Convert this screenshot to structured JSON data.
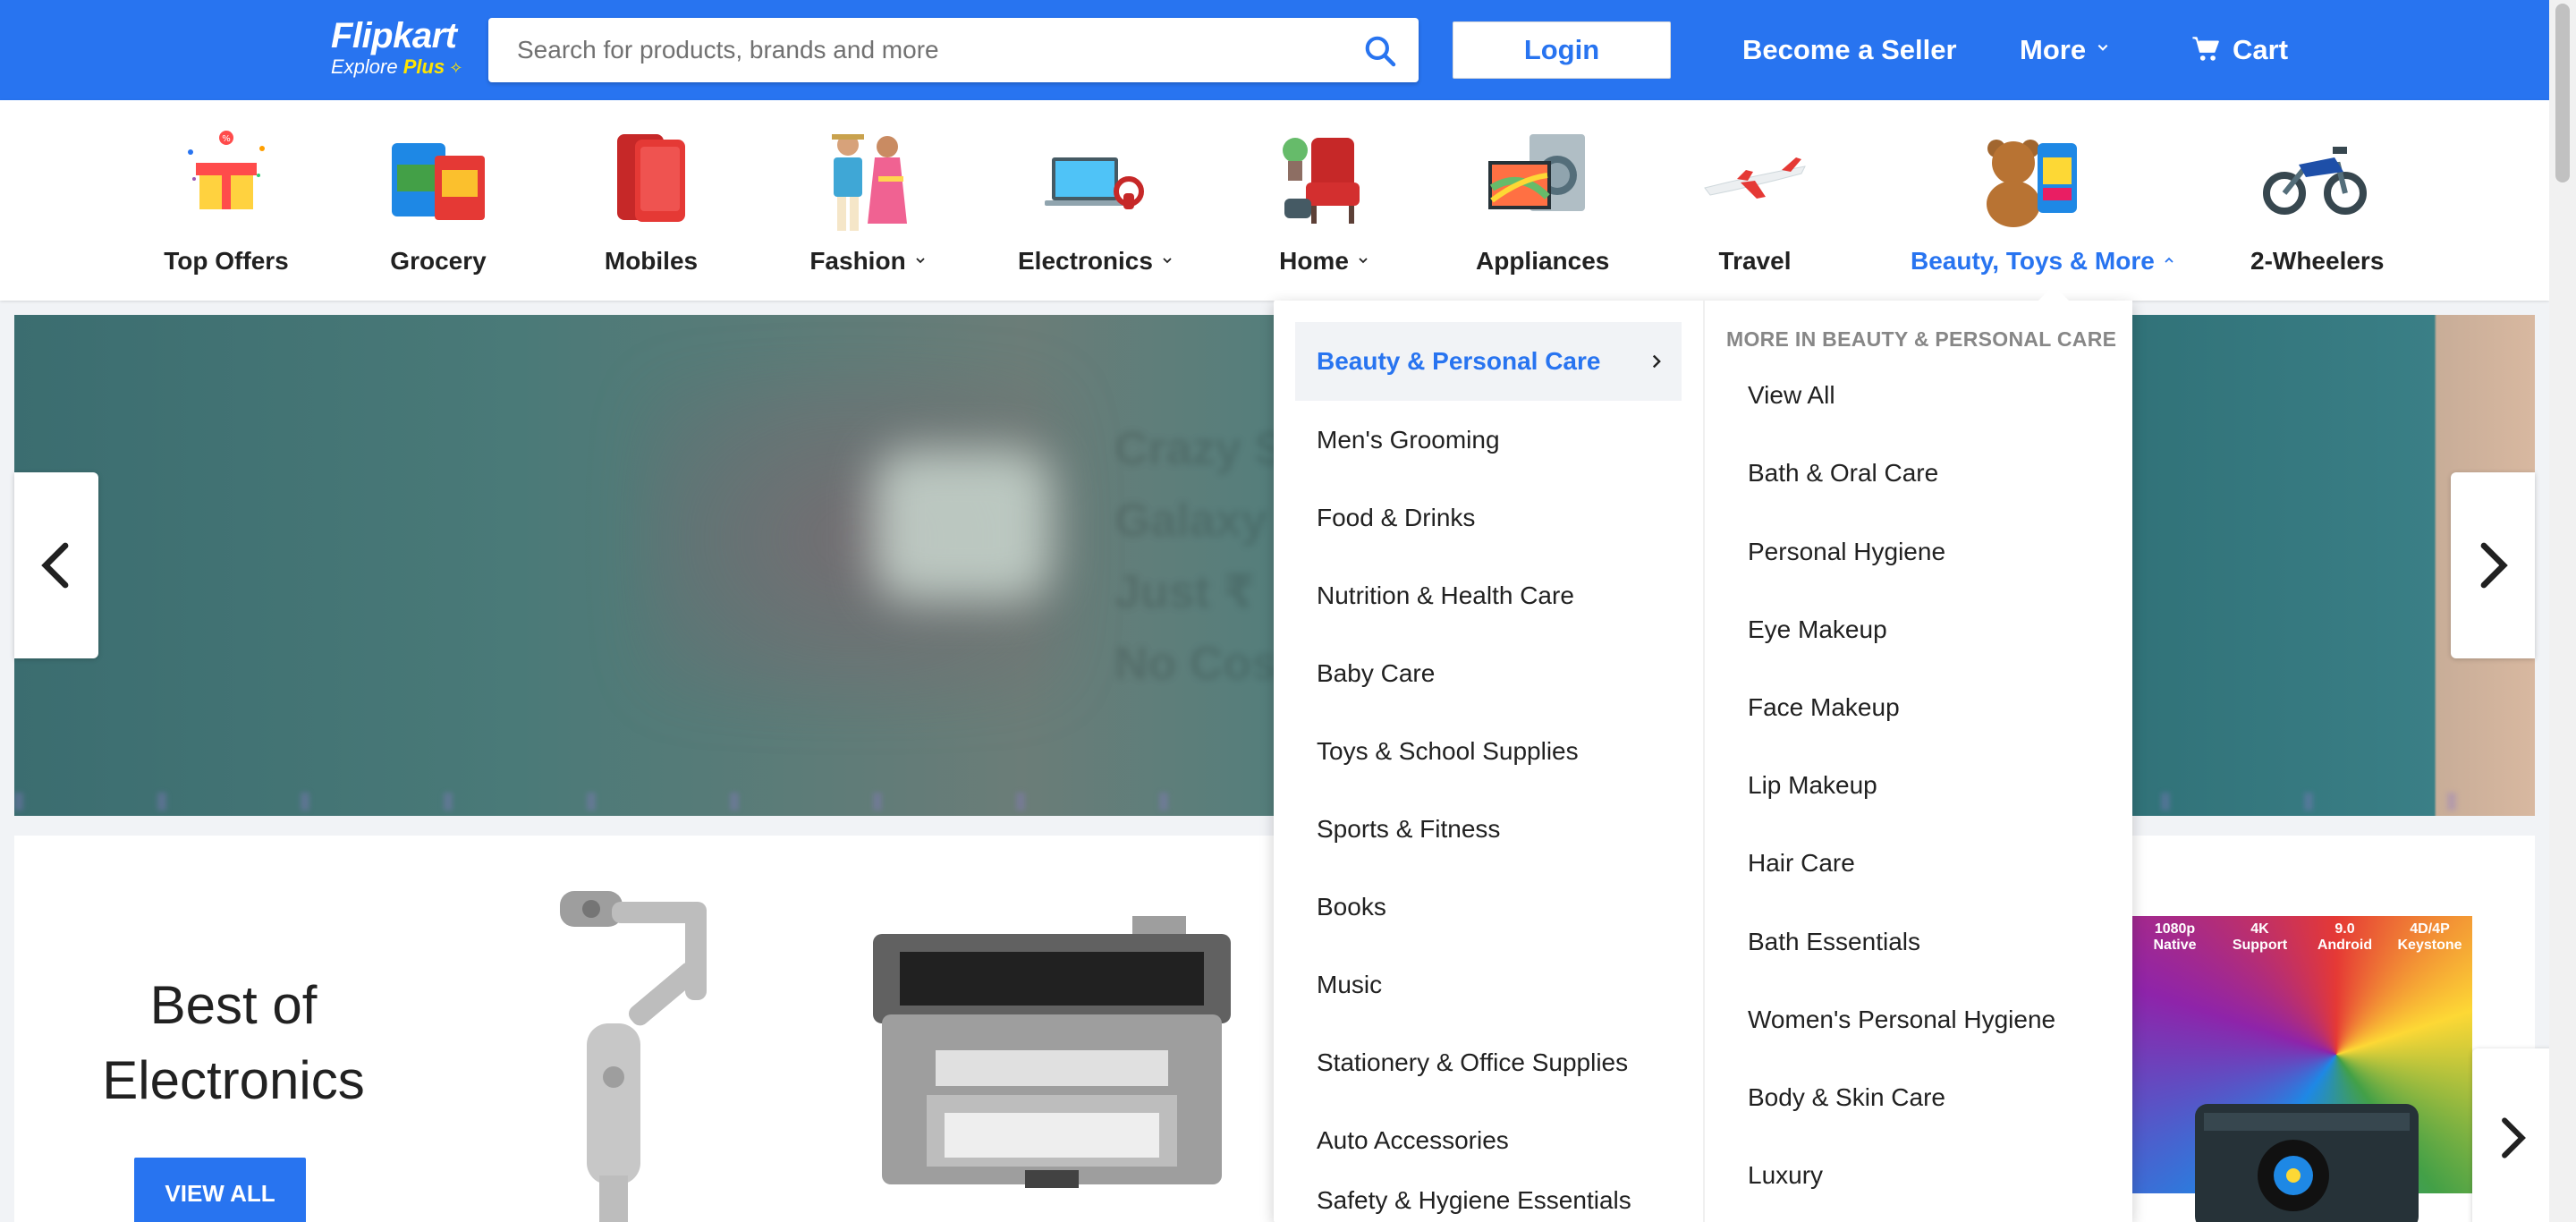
{
  "header": {
    "logo_text": "Flipkart",
    "logo_sub_explore": "Explore ",
    "logo_sub_plus": "Plus",
    "search_placeholder": "Search for products, brands and more",
    "login_label": "Login",
    "seller_label": "Become a Seller",
    "more_label": "More",
    "cart_label": "Cart",
    "brand_color": "#2874f0"
  },
  "categories": [
    {
      "label": "Top Offers",
      "icon": "gift-box-icon",
      "dropdown": false
    },
    {
      "label": "Grocery",
      "icon": "grocery-pack-icon",
      "dropdown": false
    },
    {
      "label": "Mobiles",
      "icon": "smartphone-icon",
      "dropdown": false
    },
    {
      "label": "Fashion",
      "icon": "fashion-couple-icon",
      "dropdown": true
    },
    {
      "label": "Electronics",
      "icon": "laptop-icon",
      "dropdown": true
    },
    {
      "label": "Home",
      "icon": "armchair-icon",
      "dropdown": true
    },
    {
      "label": "Appliances",
      "icon": "tv-washer-icon",
      "dropdown": false
    },
    {
      "label": "Travel",
      "icon": "airplane-icon",
      "dropdown": false
    },
    {
      "label": "Beauty, Toys & More",
      "icon": "teddy-bear-icon",
      "dropdown": true,
      "active": true
    },
    {
      "label": "2-Wheelers",
      "icon": "motorbike-icon",
      "dropdown": false
    }
  ],
  "banner": {
    "blurred_lines": [
      "Crazy S",
      "Galaxy Z",
      "Just ₹",
      "No Cost"
    ]
  },
  "best_of": {
    "title_line1": "Best of",
    "title_line2": "Electronics",
    "view_all_label": "VIEW ALL",
    "projector_badges": [
      "1080p Native",
      "4K Support",
      "9.0 Android",
      "4D/4P Keystone"
    ]
  },
  "dropdown": {
    "left_items": [
      "Beauty & Personal Care",
      "Men's Grooming",
      "Food & Drinks",
      "Nutrition & Health Care",
      "Baby Care",
      "Toys & School Supplies",
      "Sports & Fitness",
      "Books",
      "Music",
      "Stationery & Office Supplies",
      "Auto Accessories",
      "Safety & Hygiene Essentials"
    ],
    "right_heading": "MORE IN BEAUTY & PERSONAL CARE",
    "right_items": [
      "View All",
      "Bath & Oral Care",
      "Personal Hygiene",
      "Eye Makeup",
      "Face Makeup",
      "Lip Makeup",
      "Hair Care",
      "Bath Essentials",
      "Women's Personal Hygiene",
      "Body & Skin Care",
      "Luxury"
    ]
  }
}
